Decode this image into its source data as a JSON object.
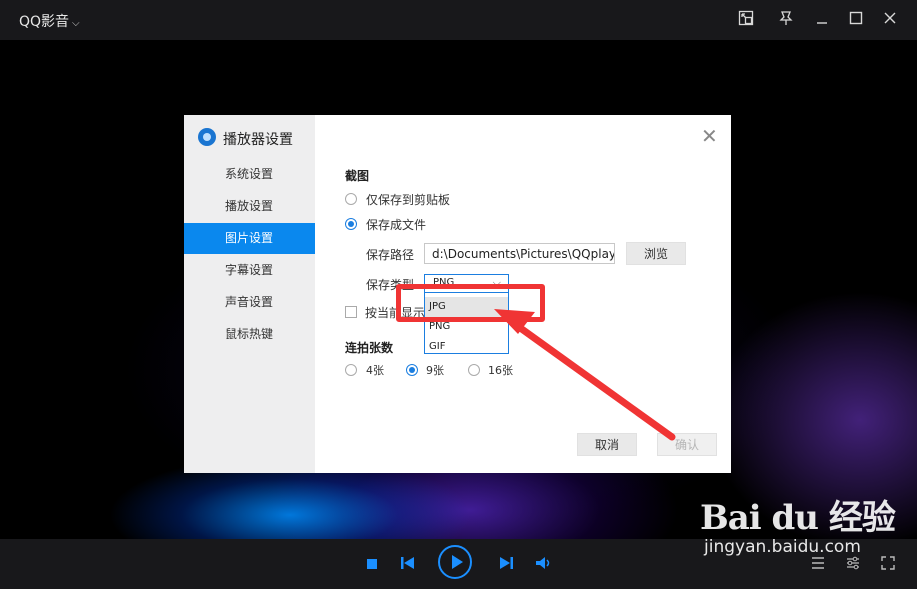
{
  "titlebar": {
    "app_title": "QQ影音",
    "icons": [
      "mini-mode-icon",
      "pin-icon",
      "minimize-icon",
      "maximize-icon",
      "close-icon"
    ]
  },
  "dialog": {
    "title": "播放器设置",
    "nav": [
      {
        "label": "系统设置",
        "active": false
      },
      {
        "label": "播放设置",
        "active": false
      },
      {
        "label": "图片设置",
        "active": true
      },
      {
        "label": "字幕设置",
        "active": false
      },
      {
        "label": "声音设置",
        "active": false
      },
      {
        "label": "鼠标热键",
        "active": false
      }
    ],
    "screenshot": {
      "heading": "截图",
      "option_clipboard": "仅保存到剪贴板",
      "option_file": "保存成文件",
      "selected": "保存成文件",
      "path_label": "保存路径",
      "path_value": "d:\\Documents\\Pictures\\QQplay",
      "browse": "浏览",
      "type_label": "保存类型",
      "type_value": "PNG",
      "type_options": [
        "JPG",
        "PNG",
        "GIF"
      ],
      "type_highlighted": "JPG",
      "display_checkbox_label": "按当前显示",
      "display_checked": false
    },
    "burst": {
      "heading": "连拍张数",
      "options": [
        "4张",
        "9张",
        "16张"
      ],
      "selected": "9张"
    },
    "cancel": "取消",
    "confirm": "确认"
  },
  "player_controls": [
    "stop-icon",
    "previous-icon",
    "play-icon",
    "next-icon",
    "volume-icon"
  ],
  "watermark": {
    "logo": "Bai du 经验",
    "url": "jingyan.baidu.com"
  },
  "colors": {
    "accent": "#0a88ee",
    "annotation": "#f03434",
    "titlebar": "#18181b"
  }
}
